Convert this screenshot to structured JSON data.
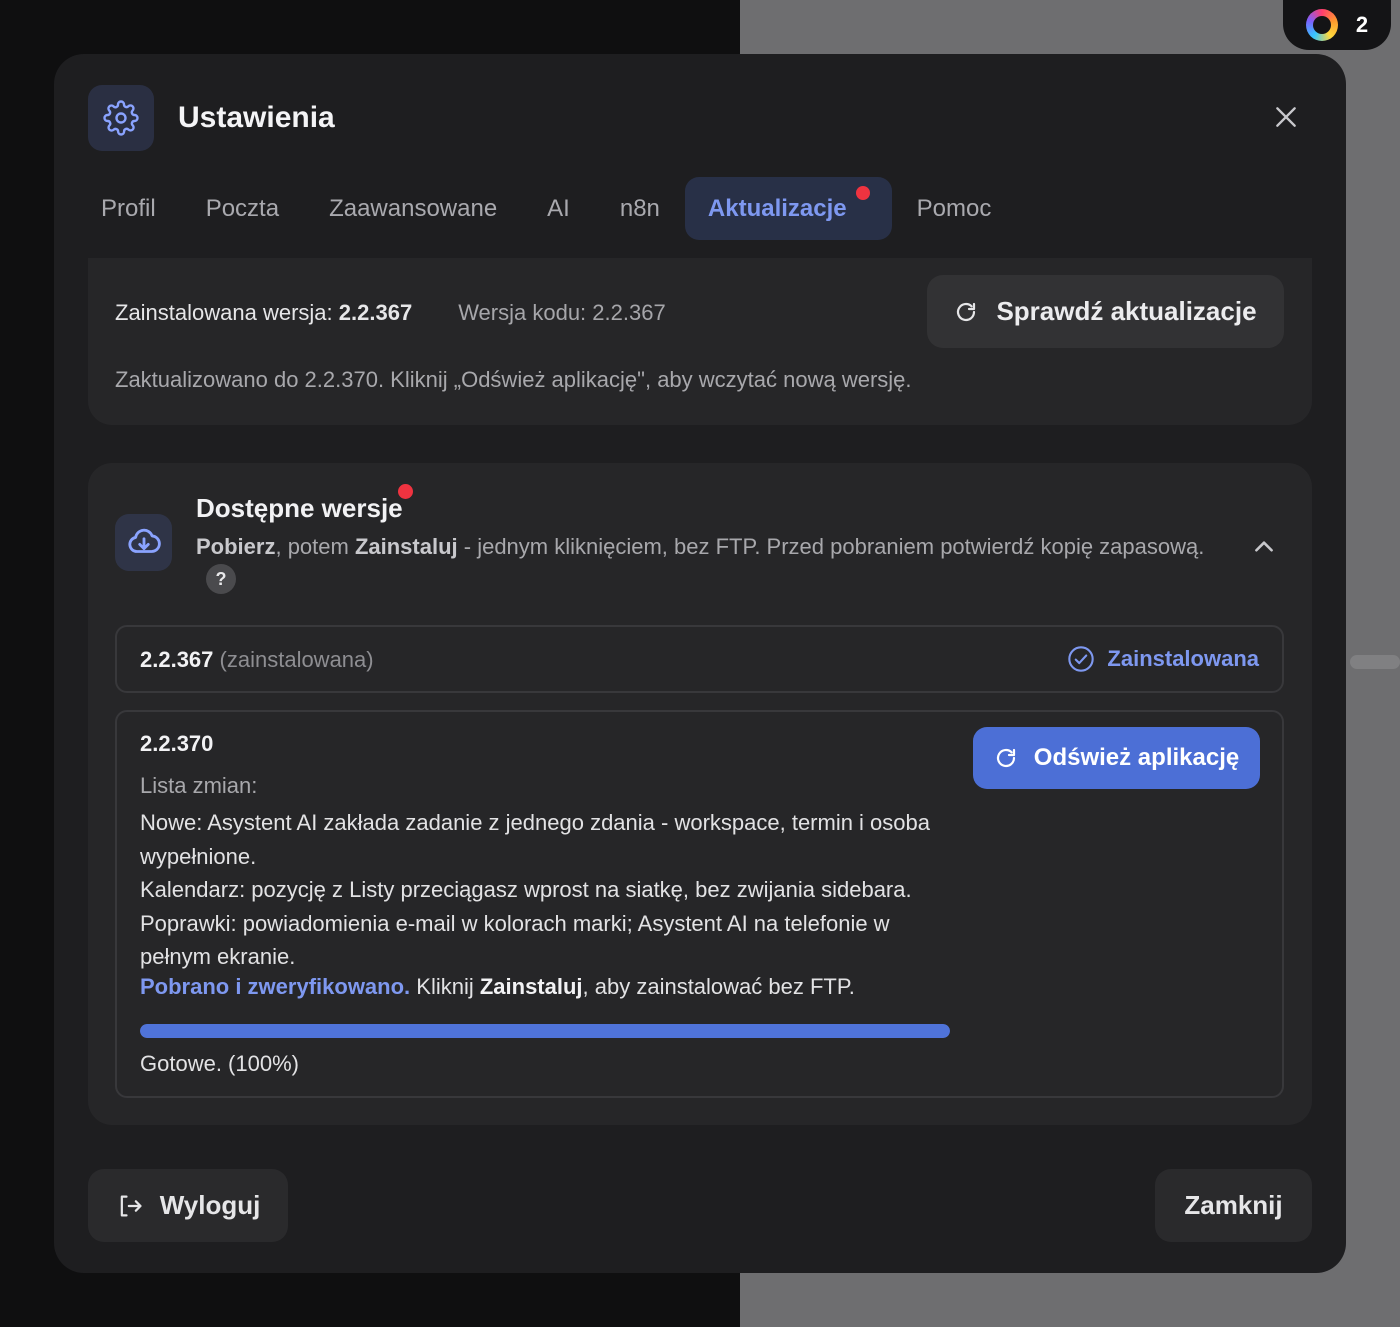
{
  "notification_badge": {
    "count": "2"
  },
  "modal": {
    "title": "Ustawienia",
    "tabs": [
      {
        "label": "Profil"
      },
      {
        "label": "Poczta"
      },
      {
        "label": "Zaawansowane"
      },
      {
        "label": "AI"
      },
      {
        "label": "n8n"
      },
      {
        "label": "Aktualizacje",
        "active": true
      },
      {
        "label": "Pomoc"
      }
    ]
  },
  "version_info": {
    "installed_label": "Zainstalowana wersja: ",
    "installed_value": "2.2.367",
    "code_version": "Wersja kodu: 2.2.367",
    "check_button": "Sprawdź aktualizacje",
    "updated_note": "Zaktualizowano do 2.2.370. Kliknij „Odśwież aplikację\", aby wczytać nową wersję."
  },
  "available": {
    "title": "Dostępne wersje",
    "desc_pobierz": "Pobierz",
    "desc_mid": ", potem ",
    "desc_zainstaluj": "Zainstaluj",
    "desc_rest": " - jednym kliknięciem, bez FTP. Przed pobraniem potwierdź kopię zapasową.",
    "help": "?",
    "installed_row": {
      "version": "2.2.367",
      "suffix": "(zainstalowana)",
      "status": "Zainstalowana"
    },
    "new_row": {
      "version": "2.2.370",
      "changes_label": "Lista zmian:",
      "changes": [
        "Nowe: Asystent AI zakłada zadanie z jednego zdania - workspace, termin i osoba wypełnione.",
        "Kalendarz: pozycję z Listy przeciągasz wprost na siatkę, bez zwijania sidebara.",
        "Poprawki: powiadomienia e-mail w kolorach marki; Asystent AI na telefonie w pełnym ekranie."
      ],
      "verified": "Pobrano i zweryfikowano.",
      "verified_mid": " Kliknij ",
      "verified_bold": "Zainstaluj",
      "verified_rest": ", aby zainstalować bez FTP.",
      "progress": 1.0,
      "status": "Gotowe. (100%)",
      "refresh_button": "Odśwież aplikację"
    }
  },
  "footer": {
    "logout": "Wyloguj",
    "close": "Zamknij"
  },
  "colors": {
    "accent": "#4c6fd6",
    "accent_text": "#7e98f0",
    "alert_dot": "#ef3340"
  }
}
